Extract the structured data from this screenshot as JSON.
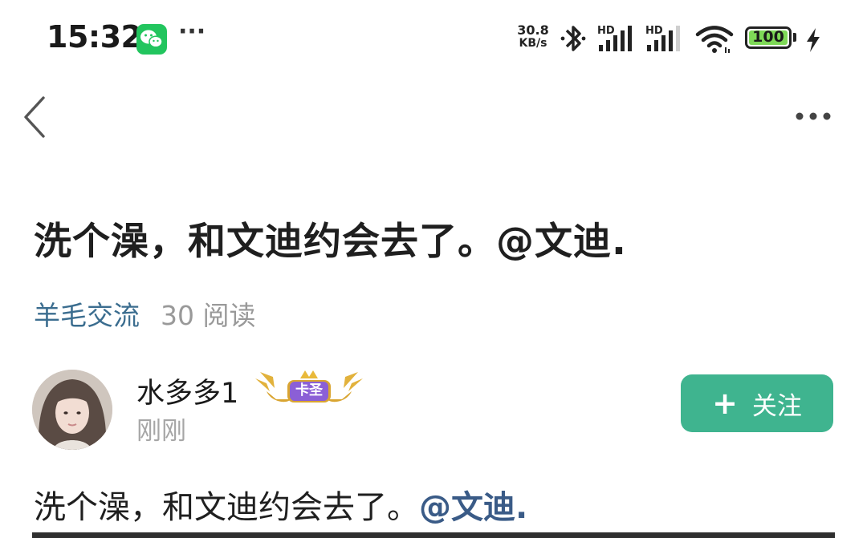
{
  "status_bar": {
    "time": "15:32",
    "more": "···",
    "net_speed": "30.8",
    "net_unit": "KB/s",
    "signal_1_label": "HD",
    "signal_2_label": "HD",
    "battery": "100",
    "icons": [
      "wechat-icon",
      "bluetooth-icon",
      "signal-icon",
      "wifi-icon",
      "battery-icon",
      "charging-bolt-icon"
    ]
  },
  "nav": {
    "back_icon": "chevron-left-icon",
    "menu_icon": "more-horizontal-icon"
  },
  "post": {
    "title": "洗个澡，和文迪约会去了。@文迪.",
    "category": "羊毛交流",
    "read_count": "30 阅读",
    "body_text": "洗个澡，和文迪约会去了。",
    "body_mention": "@文迪."
  },
  "author": {
    "name": "水多多1",
    "badge": "卡圣",
    "time": "刚刚"
  },
  "follow": {
    "plus": "+",
    "label": "关注"
  },
  "colors": {
    "accent_green": "#3fb48f",
    "category_blue": "#3b6d8f",
    "mention_blue": "#3a5b87",
    "muted_gray": "#999999",
    "battery_green": "#7ed957",
    "wechat_green": "#22c55e",
    "badge_purple": "#8b5fd6",
    "badge_gold": "#d9a531"
  }
}
